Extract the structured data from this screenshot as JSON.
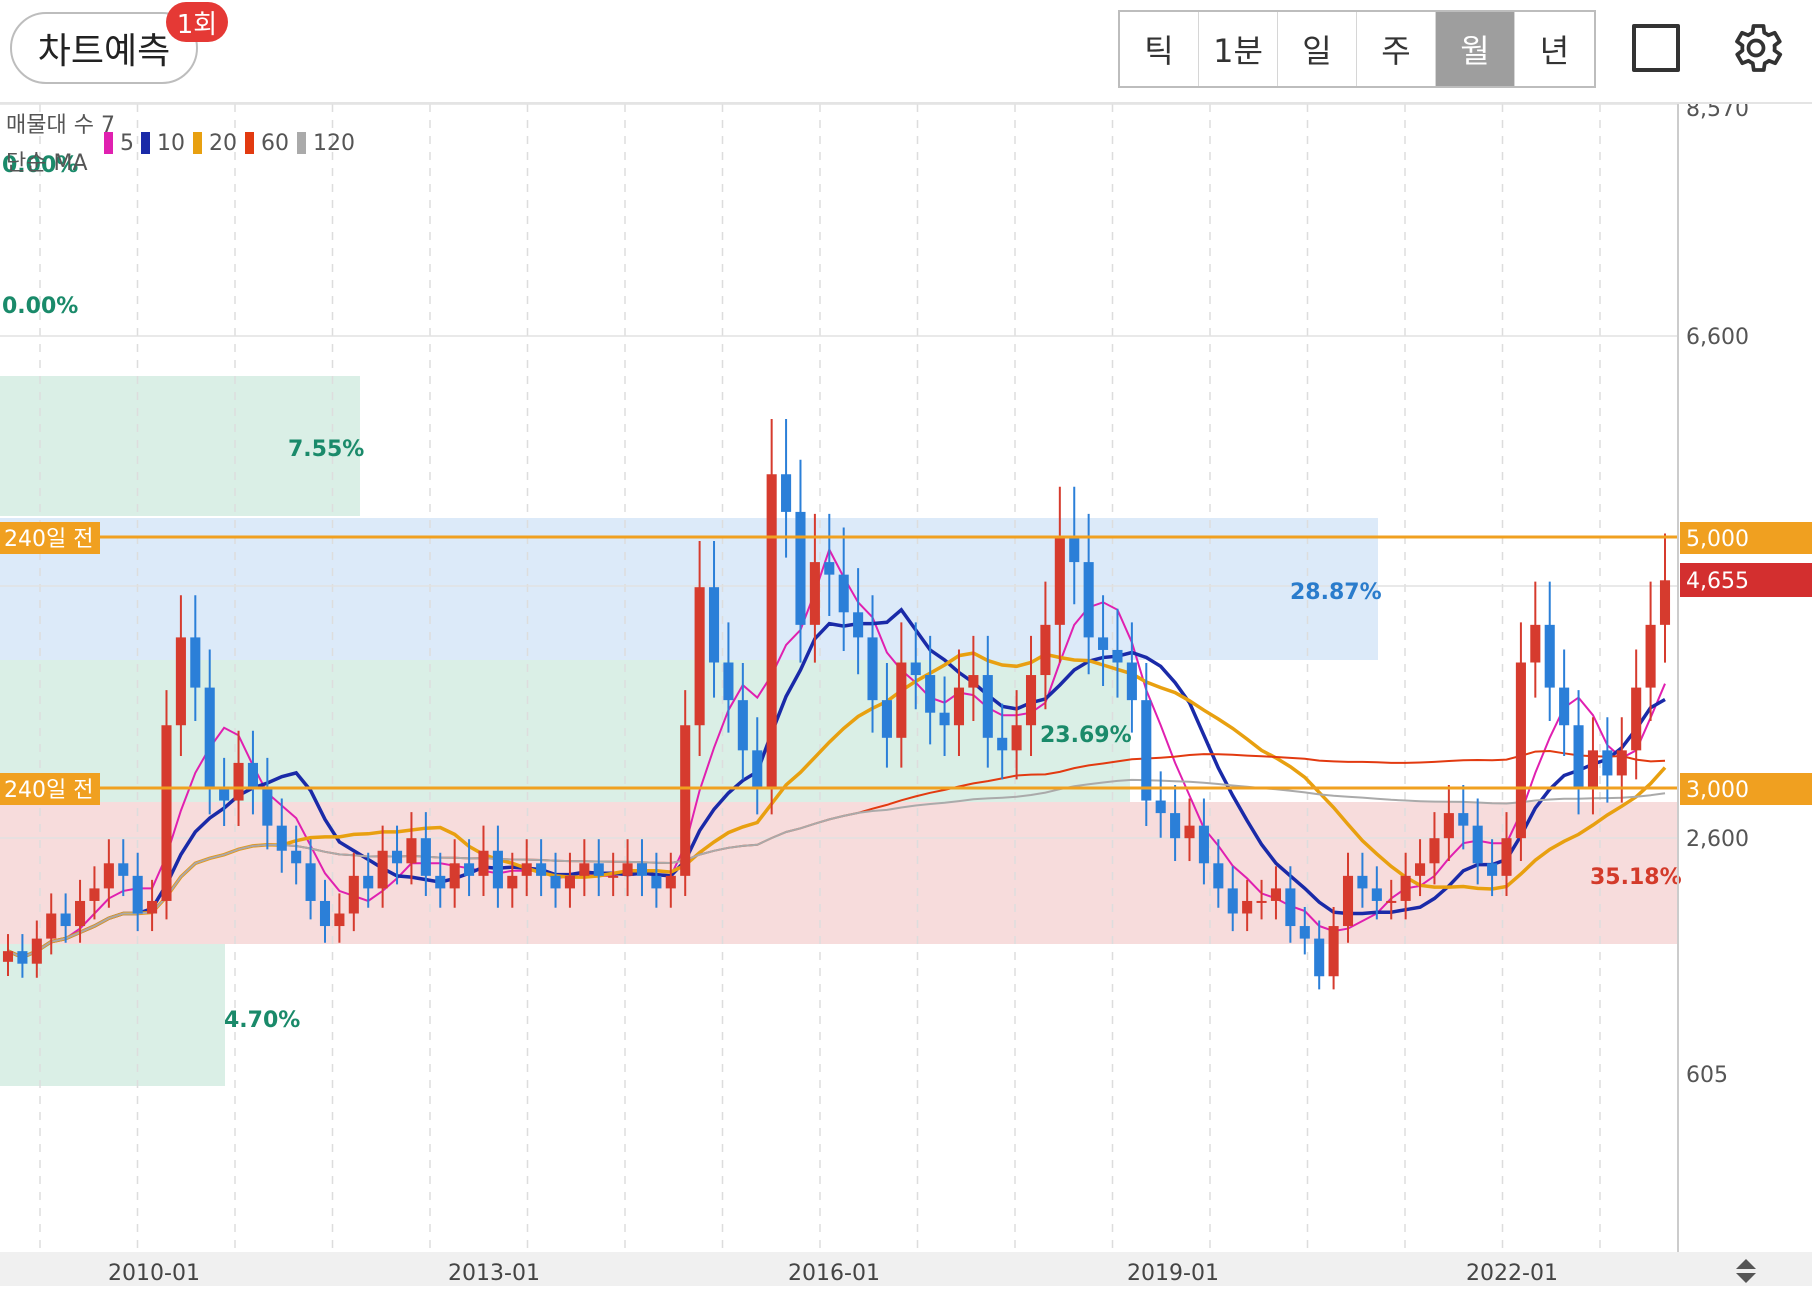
{
  "header": {
    "predict_label": "차트예측",
    "predict_badge": "1회",
    "period_tabs": [
      "틱",
      "1분",
      "일",
      "주",
      "월",
      "년"
    ],
    "active_period": "월",
    "icons": [
      "square-icon",
      "gear-icon"
    ]
  },
  "indicators": {
    "volume_profile": "매물대 수 7",
    "ma_label": "단순 MA",
    "ma_lines": [
      {
        "period": "5",
        "color": "#e020b0"
      },
      {
        "period": "10",
        "color": "#1a2aa8"
      },
      {
        "period": "20",
        "color": "#e8a010"
      },
      {
        "period": "60",
        "color": "#e23a10"
      },
      {
        "period": "120",
        "color": "#aaaaaa"
      }
    ]
  },
  "chart_data": {
    "type": "candlestick",
    "x_ticks": [
      "2010-01",
      "2013-01",
      "2016-01",
      "2019-01",
      "2022-01"
    ],
    "y_ticks": [
      "8,570",
      "6,600",
      "2,600",
      "605"
    ],
    "price_lines": [
      {
        "label": "240일 전",
        "value": 5000,
        "axis_label": "5,000",
        "color": "#f0a020"
      },
      {
        "label": "240일 전",
        "value": 3000,
        "axis_label": "3,000",
        "color": "#f0a020"
      }
    ],
    "current_price": {
      "value": 4655,
      "label": "4,655",
      "color": "#d32f2f"
    },
    "percent_labels": [
      "0.00%",
      "0.00%",
      "7.55%",
      "28.87%",
      "23.69%",
      "35.18%",
      "4.70%"
    ],
    "zones": [
      {
        "label": "7.55%",
        "color": "green"
      },
      {
        "label": "28.87%",
        "color": "blue"
      },
      {
        "label": "23.69%",
        "color": "green"
      },
      {
        "label": "35.18%",
        "color": "red"
      },
      {
        "label": "4.70%",
        "color": "green"
      }
    ],
    "candles_monthly_close_approx": [
      1700,
      1600,
      1800,
      2000,
      1900,
      2100,
      2200,
      2400,
      2300,
      2000,
      2100,
      3500,
      4200,
      3800,
      3000,
      2900,
      3200,
      3000,
      2700,
      2500,
      2400,
      2100,
      1900,
      2000,
      2300,
      2200,
      2500,
      2400,
      2600,
      2300,
      2200,
      2400,
      2300,
      2500,
      2200,
      2300,
      2400,
      2300,
      2200,
      2300,
      2400,
      2300,
      2300,
      2400,
      2300,
      2200,
      2300,
      3500,
      4600,
      4000,
      3700,
      3300,
      3000,
      5500,
      5200,
      4300,
      4800,
      4700,
      4400,
      4200,
      3700,
      3400,
      4000,
      3900,
      3600,
      3500,
      3800,
      3900,
      3400,
      3300,
      3500,
      3900,
      4300,
      5000,
      4800,
      4200,
      4100,
      4000,
      3700,
      2900,
      2800,
      2600,
      2700,
      2400,
      2200,
      2000,
      2100,
      2100,
      2200,
      1900,
      1800,
      1500,
      1900,
      2300,
      2200,
      2100,
      2100,
      2300,
      2400,
      2600,
      2800,
      2700,
      2400,
      2300,
      2600,
      4000,
      4300,
      3800,
      3500,
      3000,
      3300,
      3100,
      3300,
      3800,
      4300,
      4655
    ]
  }
}
